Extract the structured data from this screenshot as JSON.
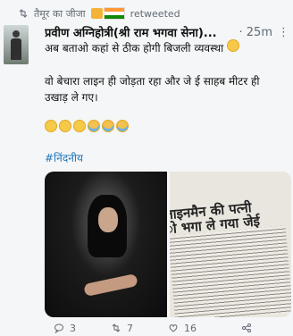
{
  "retweet": {
    "user": "तैमूर का जीजा",
    "label": "retweeted"
  },
  "tweet": {
    "author": "प्रवीण अग्निहोत्री(श्री राम भगवा सेना)...",
    "time": "· 25m",
    "more": "⋮",
    "line1": "अब बताओ कहां से ठीक होगी बिजली व्यवस्था",
    "line2": "वो बेचारा लाइन ही जोड़ता रहा और जे ई साहब मीटर ही उखाड़ ले गए।",
    "hashtag": "#निंदनीय",
    "newspaper_headline_1": "लाइनमैन की पत्नी",
    "newspaper_headline_2": "ो भगा ले गया जेई"
  },
  "actions": {
    "replies": "3",
    "retweets": "7",
    "likes": "16"
  },
  "icons": [
    "retweet-icon",
    "flexed-biceps-emoji",
    "indian-flag-emoji",
    "worried-face-emoji",
    "reply-icon",
    "like-icon",
    "share-icon"
  ]
}
